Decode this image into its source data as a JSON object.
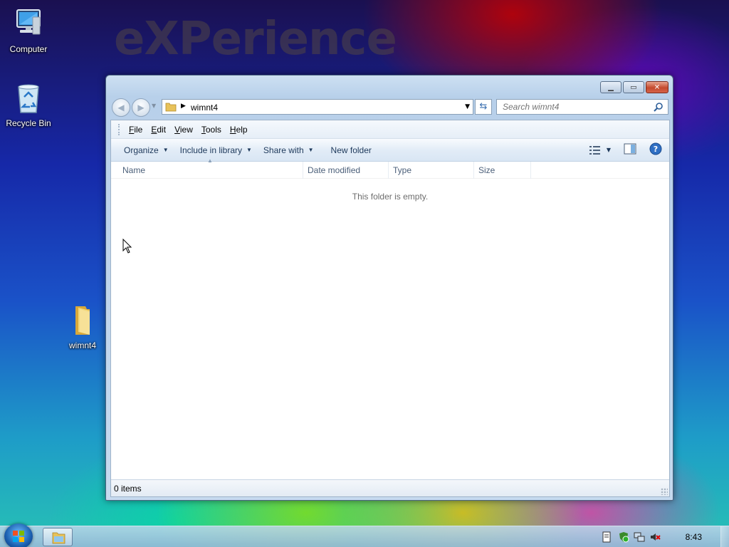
{
  "desktop": {
    "watermark": "eXPerience",
    "icons": [
      {
        "label": "Computer",
        "icon": "computer-icon"
      },
      {
        "label": "Recycle Bin",
        "icon": "recycle-bin-icon"
      },
      {
        "label": "wimnt4",
        "icon": "folder-icon"
      }
    ]
  },
  "window": {
    "address": {
      "path": "wimnt4"
    },
    "search": {
      "placeholder": "Search wimnt4"
    },
    "menu": [
      {
        "key": "F",
        "rest": "ile"
      },
      {
        "key": "E",
        "rest": "dit"
      },
      {
        "key": "V",
        "rest": "iew"
      },
      {
        "key": "T",
        "rest": "ools"
      },
      {
        "key": "H",
        "rest": "elp"
      }
    ],
    "commands": {
      "organize": "Organize",
      "include_in_library": "Include in library",
      "share_with": "Share with",
      "new_folder": "New folder"
    },
    "columns": [
      "Name",
      "Date modified",
      "Type",
      "Size"
    ],
    "empty_message": "This folder is empty.",
    "status": "0 items"
  },
  "taskbar": {
    "clock": "8:43"
  },
  "colors": {
    "accent": "#1e395b",
    "window_frame": "#b8d0ea",
    "close_button": "#c44a2e"
  }
}
